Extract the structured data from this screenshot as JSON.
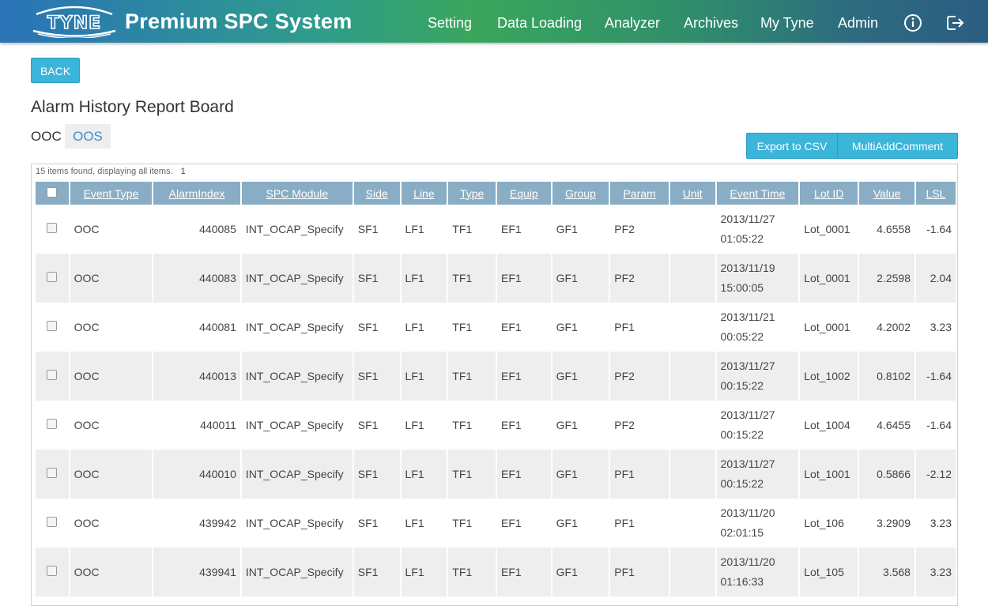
{
  "header": {
    "logo_text": "TYNE",
    "brand": "Premium SPC System",
    "nav": [
      "Setting",
      "Data Loading",
      "Analyzer",
      "Archives",
      "My Tyne",
      "Admin"
    ],
    "icons": [
      "info-icon",
      "logout-icon"
    ],
    "colors": {
      "gradient_start": "#2a73b8",
      "gradient_mid": "#3aa65c",
      "gradient_end": "#2b5d82"
    }
  },
  "page": {
    "back_label": "BACK",
    "title": "Alarm History Report Board",
    "tabs": [
      "OOC",
      "OOS"
    ],
    "export_label": "Export to CSV",
    "multi_comment_label": "MultiAddComment",
    "accent_color": "#3bb5da"
  },
  "table": {
    "summary": "15 items found, displaying all items.",
    "page": "1",
    "columns": [
      "Event Type",
      "AlarmIndex",
      "SPC Module",
      "Side",
      "Line",
      "Type",
      "Equip",
      "Group",
      "Param",
      "Unit",
      "Event Time",
      "Lot ID",
      "Value",
      "LSL"
    ],
    "header_color": "#88adc4",
    "rows": [
      {
        "event_type": "OOC",
        "alarm_index": "440085",
        "module": "INT_OCAP_Specify",
        "side": "SF1",
        "line": "LF1",
        "type": "TF1",
        "equip": "EF1",
        "group": "GF1",
        "param": "PF2",
        "unit": "",
        "date": "2013/11/27",
        "time": "01:05:22",
        "lot": "Lot_0001",
        "value": "4.6558",
        "lsl": "-1.64"
      },
      {
        "event_type": "OOC",
        "alarm_index": "440083",
        "module": "INT_OCAP_Specify",
        "side": "SF1",
        "line": "LF1",
        "type": "TF1",
        "equip": "EF1",
        "group": "GF1",
        "param": "PF2",
        "unit": "",
        "date": "2013/11/19",
        "time": "15:00:05",
        "lot": "Lot_0001",
        "value": "2.2598",
        "lsl": "2.04"
      },
      {
        "event_type": "OOC",
        "alarm_index": "440081",
        "module": "INT_OCAP_Specify",
        "side": "SF1",
        "line": "LF1",
        "type": "TF1",
        "equip": "EF1",
        "group": "GF1",
        "param": "PF1",
        "unit": "",
        "date": "2013/11/21",
        "time": "00:05:22",
        "lot": "Lot_0001",
        "value": "4.2002",
        "lsl": "3.23"
      },
      {
        "event_type": "OOC",
        "alarm_index": "440013",
        "module": "INT_OCAP_Specify",
        "side": "SF1",
        "line": "LF1",
        "type": "TF1",
        "equip": "EF1",
        "group": "GF1",
        "param": "PF2",
        "unit": "",
        "date": "2013/11/27",
        "time": "00:15:22",
        "lot": "Lot_1002",
        "value": "0.8102",
        "lsl": "-1.64"
      },
      {
        "event_type": "OOC",
        "alarm_index": "440011",
        "module": "INT_OCAP_Specify",
        "side": "SF1",
        "line": "LF1",
        "type": "TF1",
        "equip": "EF1",
        "group": "GF1",
        "param": "PF2",
        "unit": "",
        "date": "2013/11/27",
        "time": "00:15:22",
        "lot": "Lot_1004",
        "value": "4.6455",
        "lsl": "-1.64"
      },
      {
        "event_type": "OOC",
        "alarm_index": "440010",
        "module": "INT_OCAP_Specify",
        "side": "SF1",
        "line": "LF1",
        "type": "TF1",
        "equip": "EF1",
        "group": "GF1",
        "param": "PF1",
        "unit": "",
        "date": "2013/11/27",
        "time": "00:15:22",
        "lot": "Lot_1001",
        "value": "0.5866",
        "lsl": "-2.12"
      },
      {
        "event_type": "OOC",
        "alarm_index": "439942",
        "module": "INT_OCAP_Specify",
        "side": "SF1",
        "line": "LF1",
        "type": "TF1",
        "equip": "EF1",
        "group": "GF1",
        "param": "PF1",
        "unit": "",
        "date": "2013/11/20",
        "time": "02:01:15",
        "lot": "Lot_106",
        "value": "3.2909",
        "lsl": "3.23"
      },
      {
        "event_type": "OOC",
        "alarm_index": "439941",
        "module": "INT_OCAP_Specify",
        "side": "SF1",
        "line": "LF1",
        "type": "TF1",
        "equip": "EF1",
        "group": "GF1",
        "param": "PF1",
        "unit": "",
        "date": "2013/11/20",
        "time": "01:16:33",
        "lot": "Lot_105",
        "value": "3.568",
        "lsl": "3.23"
      }
    ]
  }
}
